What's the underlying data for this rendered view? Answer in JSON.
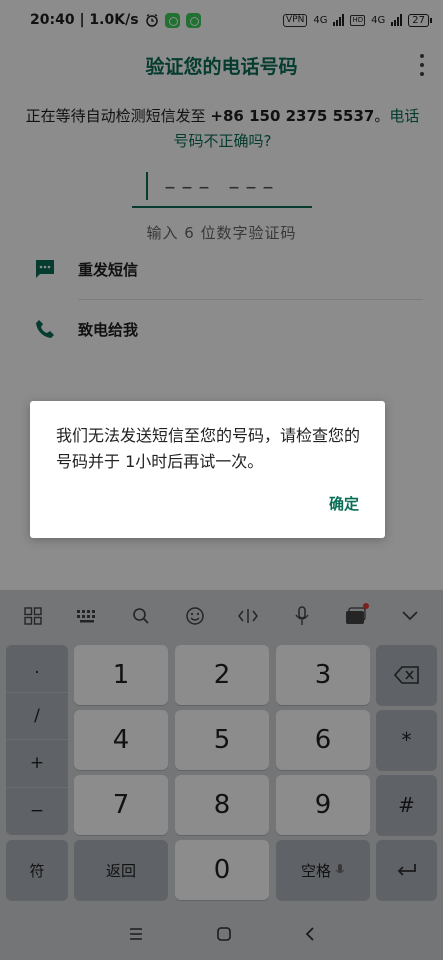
{
  "status": {
    "time_speed": "20:40 | 1.0K/s",
    "vpn": "VPN",
    "net1": "4G",
    "hd": "HD",
    "net2": "4G",
    "battery": "27"
  },
  "app": {
    "title": "验证您的电话号码",
    "desc_prefix": "正在等待自动检测短信发至 ",
    "phone": "+86 150 2375 5537",
    "desc_period": "。",
    "wrong_link": "电话号码不正确吗?",
    "code_placeholder": "––– –––",
    "hint": "输入 6 位数字验证码",
    "resend_label": "重发短信",
    "call_label": "致电给我"
  },
  "dialog": {
    "message": "我们无法发送短信至您的号码，请检查您的号码并于 1小时后再试一次。",
    "ok_label": "确定"
  },
  "keyboard": {
    "side_keys": [
      ".",
      "/",
      "+",
      "−"
    ],
    "digits": [
      "1",
      "2",
      "3",
      "4",
      "5",
      "6",
      "7",
      "8",
      "9",
      "0"
    ],
    "star": "*",
    "hash": "#",
    "symbol_label": "符",
    "back_label": "返回",
    "space_label": "空格"
  }
}
